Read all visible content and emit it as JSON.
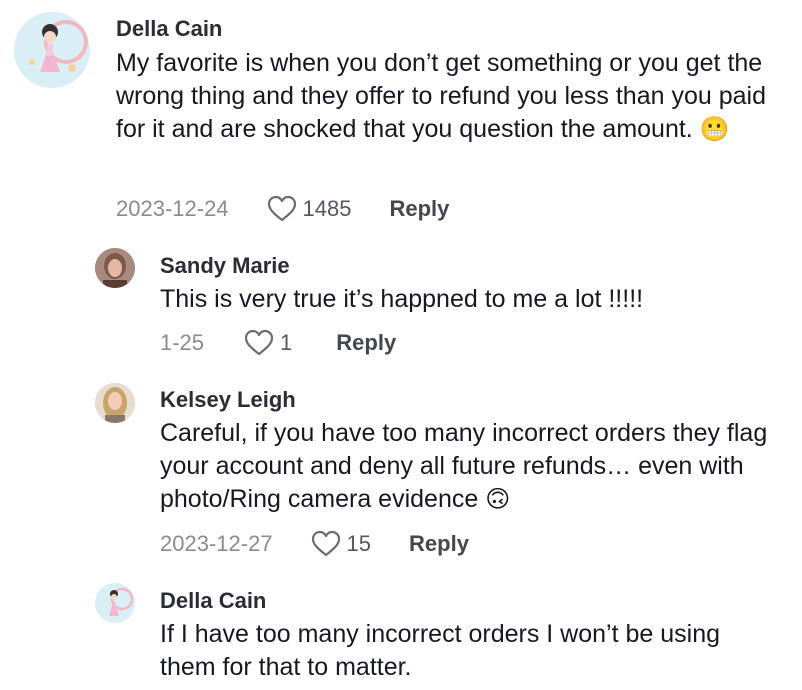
{
  "comments": [
    {
      "author": "Della Cain",
      "text": "My favorite is when you don’t get something or you get the wrong thing and they offer to refund you less than you paid for it and are shocked that you question the amount.",
      "emoji": "😬",
      "date": "2023-12-24",
      "likes": "1485",
      "reply_label": "Reply"
    },
    {
      "author": "Sandy Marie",
      "text": "This is very true it’s happned to me a lot !!!!!",
      "date": "1-25",
      "likes": "1",
      "reply_label": "Reply"
    },
    {
      "author": "Kelsey Leigh",
      "text": "Careful, if you have too many incorrect orders they flag your account and deny all future refunds… even with photo/Ring camera evidence",
      "emoji": "🙃",
      "date": "2023-12-27",
      "likes": "15",
      "reply_label": "Reply"
    },
    {
      "author": "Della Cain",
      "text": "If I have too many incorrect orders I won’t be using them for that to matter."
    }
  ],
  "icons": {
    "like": "heart-outline-icon"
  }
}
